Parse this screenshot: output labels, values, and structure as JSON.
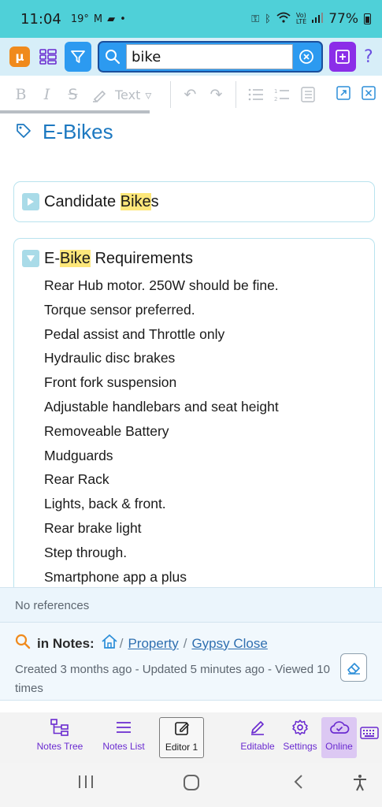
{
  "status_bar": {
    "time": "11:04",
    "temp": "19°",
    "battery": "77%"
  },
  "search": {
    "value": "bike"
  },
  "format_toolbar": {
    "text_style": "Text"
  },
  "note": {
    "title": "E-Bikes"
  },
  "collapsed_section": {
    "title_pre": "Candidate ",
    "title_hl": "Bike",
    "title_post": "s"
  },
  "expanded_section": {
    "title_pre": "E-",
    "title_hl": "Bike",
    "title_post": " Requirements",
    "items": [
      "Rear Hub motor. 250W should be fine.",
      "Torque sensor preferred.",
      "Pedal assist and Throttle only",
      "Hydraulic disc brakes",
      "Front fork suspension",
      "Adjustable handlebars and seat height",
      "Removeable Battery",
      "Mudguards",
      "Rear Rack",
      "Lights, back & front.",
      "Rear brake light",
      "Step through.",
      "Smartphone app a plus"
    ]
  },
  "references": {
    "text": "No references"
  },
  "info": {
    "in_notes_label": "in Notes:",
    "path": [
      "Property",
      "Gypsy Close"
    ],
    "meta": "Created 3 months ago - Updated 5 minutes ago - Viewed 10 times"
  },
  "bottom_nav": {
    "notes_tree": "Notes Tree",
    "notes_list": "Notes List",
    "editor": "Editor 1",
    "editable": "Editable",
    "settings": "Settings",
    "online": "Online"
  },
  "colors": {
    "accent": "#2c9af0",
    "highlight": "#fde77a",
    "title": "#1c78c0",
    "nav": "#6a2bd0"
  }
}
